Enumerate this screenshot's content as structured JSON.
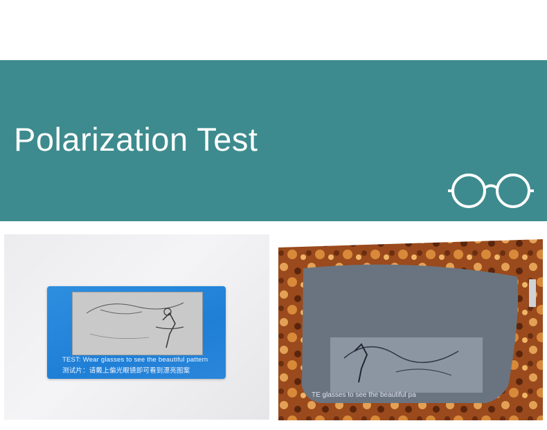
{
  "banner": {
    "title": "Polarization Test",
    "background_color": "#3d8b8e",
    "icon": "glasses-icon"
  },
  "photos": {
    "left": {
      "card_line_1": "TEST: Wear glasses to see the beautiful pattern",
      "card_line_2": "测试片：请戴上偏光眼镜即可看到漂亮图案",
      "card_color": "#2484d8"
    },
    "right": {
      "lens_text": "TE      glasses to see the beautiful pa",
      "frame_pattern": "tortoiseshell"
    }
  }
}
